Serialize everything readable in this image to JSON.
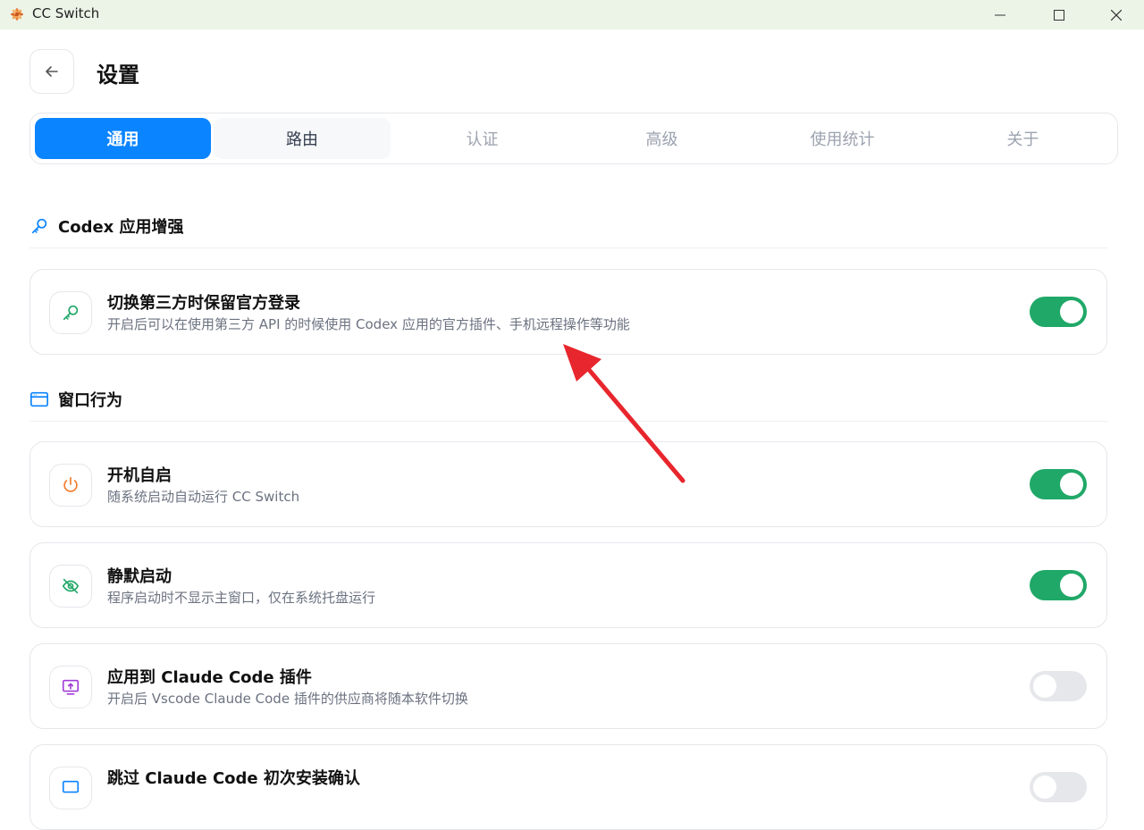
{
  "window": {
    "title": "CC Switch"
  },
  "header": {
    "title": "设置"
  },
  "tabs": [
    {
      "label": "通用",
      "state": "active"
    },
    {
      "label": "路由",
      "state": "hover"
    },
    {
      "label": "认证",
      "state": "inactive"
    },
    {
      "label": "高级",
      "state": "inactive"
    },
    {
      "label": "使用统计",
      "state": "inactive"
    },
    {
      "label": "关于",
      "state": "inactive"
    }
  ],
  "sections": {
    "codex": {
      "title": "Codex 应用增强",
      "icon": "key-icon",
      "items": [
        {
          "title": "切换第三方时保留官方登录",
          "desc": "开启后可以在使用第三方 API 的时候使用 Codex 应用的官方插件、手机远程操作等功能",
          "icon": "key-icon",
          "enabled": true
        }
      ]
    },
    "window": {
      "title": "窗口行为",
      "icon": "app-window-icon",
      "items": [
        {
          "title": "开机自启",
          "desc": "随系统启动自动运行 CC Switch",
          "icon": "power-icon",
          "enabled": true
        },
        {
          "title": "静默启动",
          "desc": "程序启动时不显示主窗口，仅在系统托盘运行",
          "icon": "eye-off-icon",
          "enabled": true
        },
        {
          "title": "应用到 Claude Code 插件",
          "desc": "开启后 Vscode Claude Code 插件的供应商将随本软件切换",
          "icon": "monitor-upload-icon",
          "enabled": false
        },
        {
          "title": "跳过 Claude Code 初次安装确认",
          "desc": "",
          "icon": "monitor-icon",
          "enabled": false
        }
      ]
    }
  },
  "colors": {
    "accent": "#0a84ff",
    "toggle_on": "#20a868",
    "annotation_arrow": "#e8262d"
  }
}
